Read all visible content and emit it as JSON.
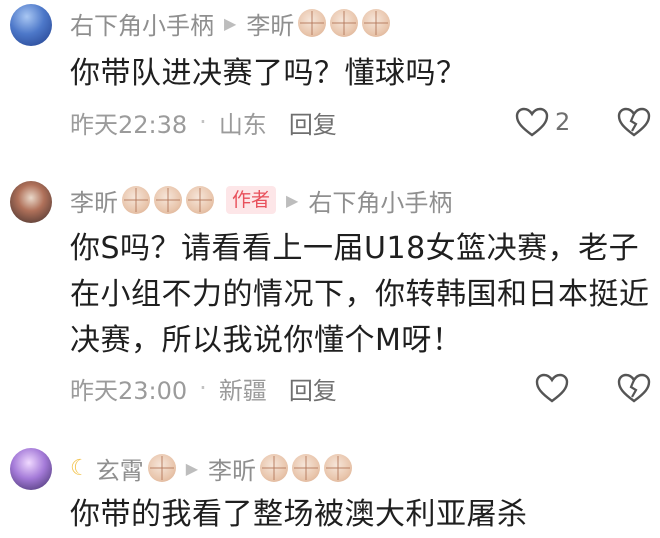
{
  "comments": [
    {
      "author": "右下角小手柄",
      "reply_to": "李昕",
      "text_lines": [
        "你带队进决赛了吗？懂球吗？"
      ],
      "time": "昨天22:38",
      "location": "山东",
      "reply_label": "回复",
      "likes": "2"
    },
    {
      "author": "李昕",
      "author_badge": "作者",
      "reply_to": "右下角小手柄",
      "text_lines": [
        "你S吗？请看看上一届U18女篮决赛，老子",
        "在小组不力的情况下，你转韩国和日本挺近",
        "决赛，所以我说你懂个M呀！"
      ],
      "time": "昨天23:00",
      "location": "新疆",
      "reply_label": "回复",
      "likes": ""
    },
    {
      "author": "玄霄",
      "reply_to": "李昕",
      "text_lines": [
        "你带的我看了整场被澳大利亚屠杀"
      ]
    }
  ],
  "icons": {
    "like": "heart-outline-icon",
    "dislike": "broken-heart-icon",
    "separator": "triangle-right-icon",
    "decoration": "basketball-emoji-icon"
  },
  "colors": {
    "badge_bg": "#fde6e8",
    "badge_text": "#e8505b",
    "meta": "#8f8f8f"
  }
}
